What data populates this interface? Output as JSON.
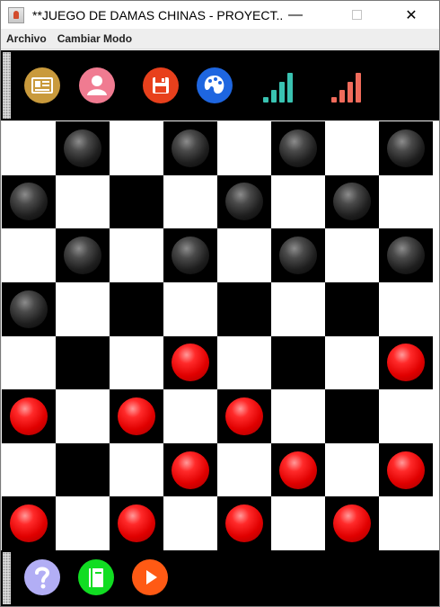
{
  "window": {
    "title": "**JUEGO DE DAMAS CHINAS - PROYECT...",
    "controls": {
      "minimize": "—",
      "maximize": "",
      "close": "✕"
    }
  },
  "menu": [
    "Archivo",
    "Cambiar Modo"
  ],
  "toolbar_top": [
    {
      "name": "profile-card-icon",
      "color": "#c99a3c"
    },
    {
      "name": "user-icon",
      "color": "#f07b91"
    },
    {
      "name": "save-icon",
      "color": "#e8401c"
    },
    {
      "name": "palette-icon",
      "color": "#1e66e0"
    },
    {
      "name": "signal-bars-teal-icon",
      "color": "#39c2b1"
    },
    {
      "name": "signal-bars-red-icon",
      "color": "#f06b5b"
    }
  ],
  "toolbar_bottom": [
    {
      "name": "help-icon",
      "color": "#b2aef5"
    },
    {
      "name": "book-icon",
      "color": "#11dd22"
    },
    {
      "name": "play-icon",
      "color": "#ff5a14"
    }
  ],
  "board": {
    "size": 8,
    "colors": {
      "dark": "#000000",
      "light": "#ffffff"
    },
    "rows": [
      [
        "",
        "b",
        "",
        "b",
        "",
        "b",
        "",
        "b"
      ],
      [
        "b",
        "",
        "",
        "",
        "b",
        "",
        "b",
        ""
      ],
      [
        "",
        "b",
        "",
        "b",
        "",
        "b",
        "",
        "b"
      ],
      [
        "b",
        "",
        "",
        "",
        "",
        "",
        "",
        ""
      ],
      [
        "",
        "",
        "",
        "r",
        "",
        "",
        "",
        "r"
      ],
      [
        "r",
        "",
        "r",
        "",
        "r",
        "",
        "",
        ""
      ],
      [
        "",
        "",
        "",
        "r",
        "",
        "r",
        "",
        "r"
      ],
      [
        "r",
        "",
        "r",
        "",
        "r",
        "",
        "r",
        ""
      ]
    ],
    "cell_pattern": [
      [
        "L",
        "D",
        "L",
        "D",
        "L",
        "D",
        "L",
        "D"
      ],
      [
        "D",
        "L",
        "D",
        "L",
        "D",
        "L",
        "D",
        "L"
      ],
      [
        "L",
        "D",
        "L",
        "D",
        "L",
        "D",
        "L",
        "D"
      ],
      [
        "D",
        "L",
        "D",
        "L",
        "D",
        "L",
        "D",
        "L"
      ],
      [
        "L",
        "D",
        "L",
        "D",
        "L",
        "D",
        "L",
        "D"
      ],
      [
        "D",
        "L",
        "D",
        "L",
        "D",
        "L",
        "D",
        "L"
      ],
      [
        "L",
        "D",
        "L",
        "D",
        "L",
        "D",
        "L",
        "D"
      ],
      [
        "D",
        "L",
        "D",
        "L",
        "D",
        "L",
        "D",
        "L"
      ]
    ]
  }
}
